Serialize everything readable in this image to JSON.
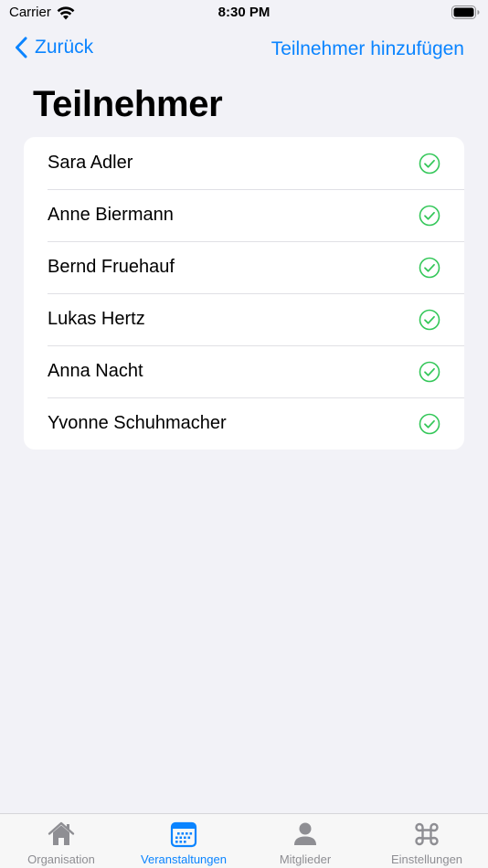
{
  "status_bar": {
    "carrier": "Carrier",
    "time": "8:30 PM"
  },
  "nav": {
    "back_label": "Zurück",
    "add_label": "Teilnehmer hinzufügen"
  },
  "page_title": "Teilnehmer",
  "participants": [
    {
      "name": "Sara Adler",
      "status": "check-circle-icon"
    },
    {
      "name": "Anne Biermann",
      "status": "check-circle-icon"
    },
    {
      "name": "Bernd Fruehauf",
      "status": "check-circle-icon"
    },
    {
      "name": "Lukas Hertz",
      "status": "check-circle-icon"
    },
    {
      "name": "Anna Nacht",
      "status": "check-circle-icon"
    },
    {
      "name": "Yvonne Schuhmacher",
      "status": "check-circle-icon"
    }
  ],
  "tabs": [
    {
      "label": "Organisation",
      "icon": "house-icon",
      "active": false
    },
    {
      "label": "Veranstaltungen",
      "icon": "calendar-icon",
      "active": true
    },
    {
      "label": "Mitglieder",
      "icon": "person-icon",
      "active": false
    },
    {
      "label": "Einstellungen",
      "icon": "command-icon",
      "active": false
    }
  ],
  "colors": {
    "accent": "#0a84ff",
    "check": "#34c759",
    "inactive_tab": "#8e8e93",
    "background": "#f2f2f7"
  }
}
